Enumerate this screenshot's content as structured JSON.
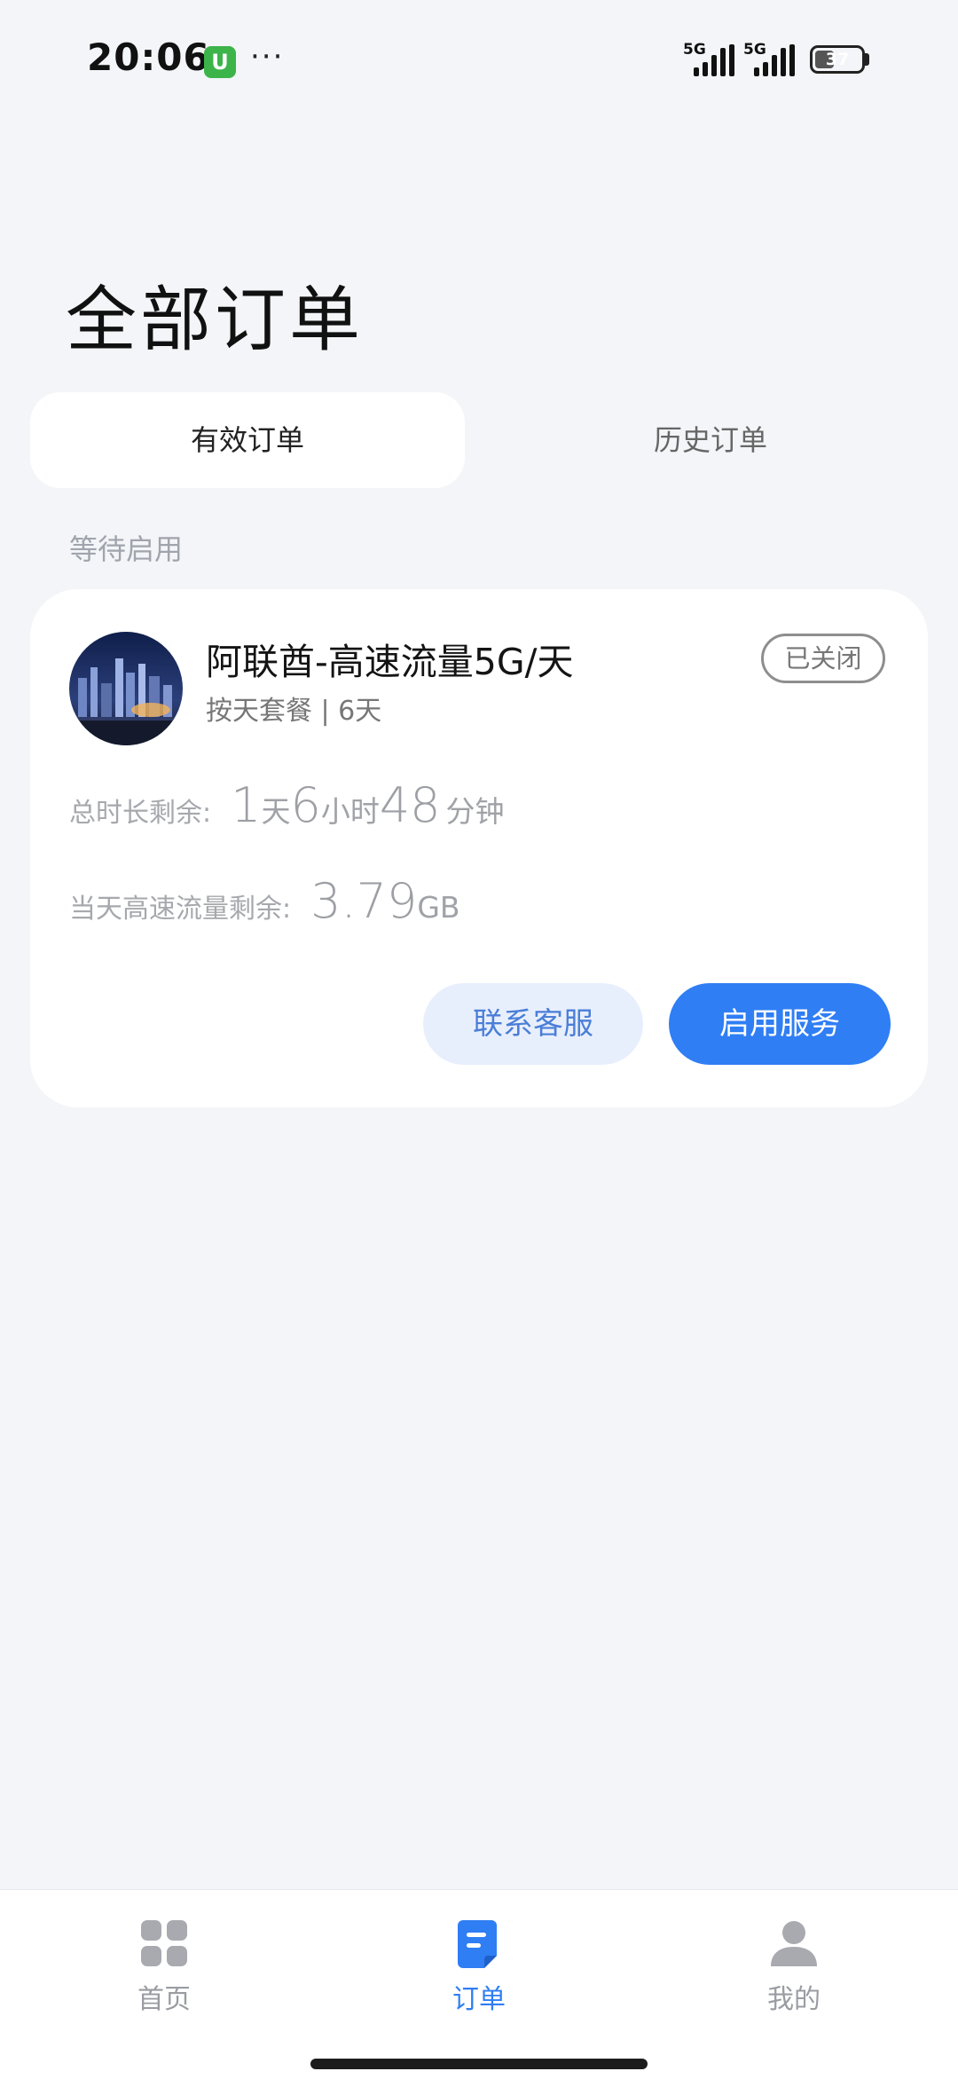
{
  "status_bar": {
    "time": "20:06",
    "app_badge": "U",
    "more": "···",
    "sim1_tag": "5G",
    "sim2_tag": "5G",
    "battery_level": "37"
  },
  "page": {
    "title": "全部订单"
  },
  "tabs": [
    {
      "label": "有效订单",
      "active": true
    },
    {
      "label": "历史订单",
      "active": false
    }
  ],
  "section_label": "等待启用",
  "order": {
    "title": "阿联酋-高速流量5G/天",
    "subtitle": "按天套餐 | 6天",
    "status": "已关闭",
    "remaining_time": {
      "label": "总时长剩余:",
      "days": "1",
      "days_unit": "天",
      "hours": "6",
      "hours_unit": "小时",
      "minutes": "48",
      "minutes_unit": "分钟"
    },
    "remaining_data": {
      "label": "当天高速流量剩余:",
      "value": "3.79",
      "unit": "GB"
    },
    "contact_button": "联系客服",
    "start_button": "启用服务"
  },
  "bottom_nav": [
    {
      "label": "首页",
      "icon": "home-grid-icon",
      "active": false
    },
    {
      "label": "订单",
      "icon": "order-document-icon",
      "active": true
    },
    {
      "label": "我的",
      "icon": "user-profile-icon",
      "active": false
    }
  ],
  "colors": {
    "accent": "#2f7ef4",
    "background": "#f4f5f8",
    "inactive_nav": "#a8aab0"
  }
}
